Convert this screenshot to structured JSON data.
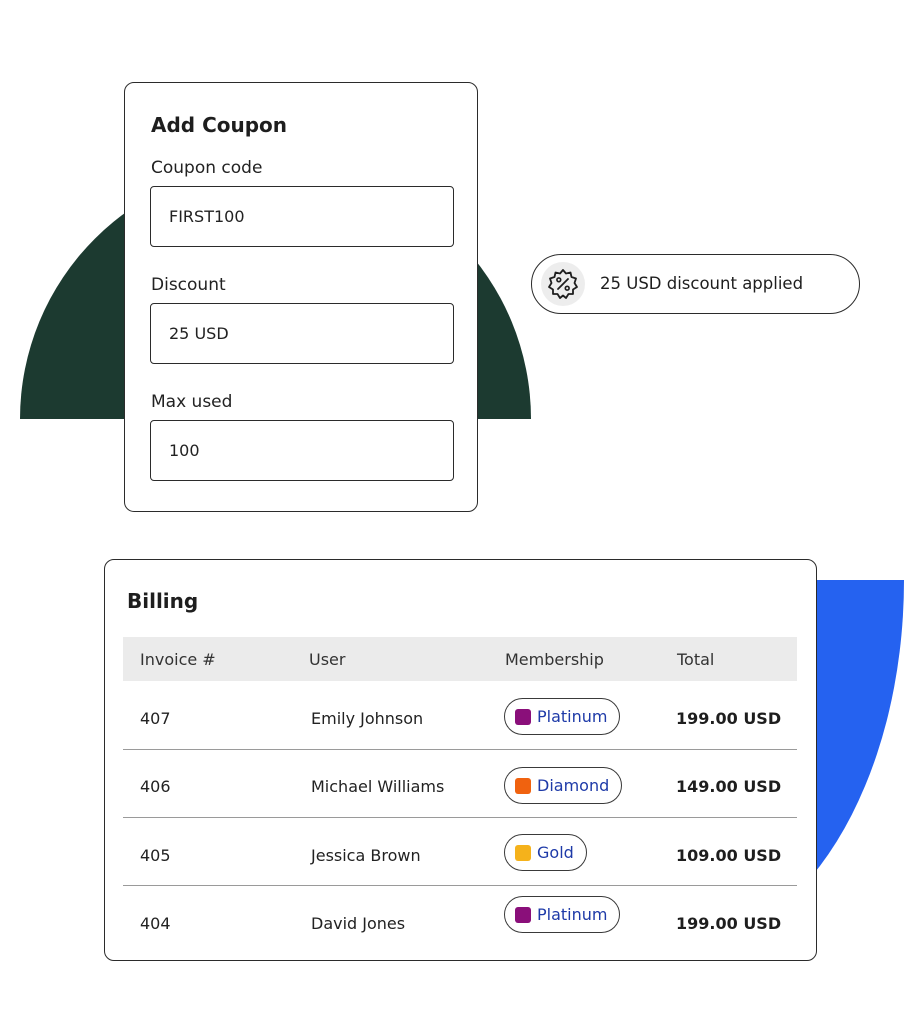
{
  "coupon": {
    "title": "Add Coupon",
    "fields": [
      {
        "label": "Coupon code",
        "value": "FIRST100"
      },
      {
        "label": "Discount",
        "value": "25 USD"
      },
      {
        "label": "Max used",
        "value": "100"
      }
    ]
  },
  "badge": {
    "icon": "discount-percent-icon",
    "text": "25 USD discount applied"
  },
  "billing": {
    "title": "Billing",
    "columns": [
      "Invoice #",
      "User",
      "Membership",
      "Total"
    ],
    "rows": [
      {
        "invoice": "407",
        "user": "Emily Johnson",
        "membership": "Platinum",
        "membership_color": "#8a0f7a",
        "total": "199.00 USD"
      },
      {
        "invoice": "406",
        "user": "Michael Williams",
        "membership": "Diamond",
        "membership_color": "#f0620f",
        "total": "149.00 USD"
      },
      {
        "invoice": "405",
        "user": "Jessica Brown",
        "membership": "Gold",
        "membership_color": "#f5b21b",
        "total": "109.00 USD"
      },
      {
        "invoice": "404",
        "user": "David Jones",
        "membership": "Platinum",
        "membership_color": "#8a0f7a",
        "total": "199.00 USD"
      }
    ]
  },
  "colors": {
    "accent_dark_green": "#1c3a30",
    "accent_blue": "#2562f0",
    "link_blue": "#1e3aa8"
  }
}
